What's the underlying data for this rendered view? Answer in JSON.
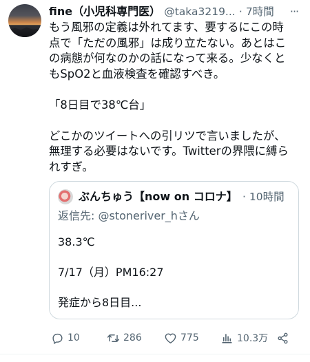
{
  "tweet": {
    "author_name": "fine（小児科専門医）",
    "handle": "@taka3219...",
    "dot": "·",
    "time": "7時間",
    "more": "···",
    "body_lines": [
      "もう風邪の定義は外れてます、要するにこの時",
      "点で「ただの風邪」は成り立たない。あとはこ",
      "の病態が何なのかの話になって来る。少なくと",
      "もSpO2と血液検査を確認すべき。",
      "",
      "「8日目で38℃台」",
      "",
      "どこかのツイートへの引リツで言いましたが、",
      "無理する必要はないです。Twitterの界隈に縛ら",
      "れすぎ。"
    ]
  },
  "quote": {
    "author_name": "ぶんちゅう【now on コロナ】",
    "dot": "·",
    "time": "10時間",
    "reply_prefix": "返信先: ",
    "reply_to": "@stoneriver_hさん",
    "body_lines": [
      "38.3℃",
      "",
      "7/17（月）PM16:27",
      "",
      "発症から8日目..."
    ]
  },
  "actions": {
    "replies": "10",
    "retweets": "286",
    "likes": "775",
    "views": "10.3万"
  },
  "icons": {
    "reply": "reply-icon",
    "retweet": "retweet-icon",
    "like": "heart-icon",
    "views": "views-icon",
    "share": "share-icon"
  }
}
